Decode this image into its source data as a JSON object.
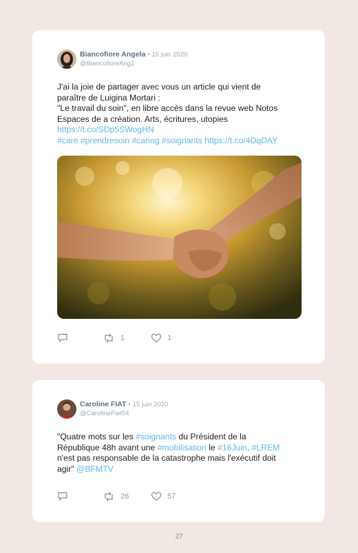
{
  "page_number": "27",
  "colors": {
    "background": "#f1e8e4",
    "card": "#ffffff",
    "name": "#5b6d84",
    "meta": "#9aa7b6",
    "link": "#5fb7e6"
  },
  "tweets": [
    {
      "author_name": "Biancofiore Angela",
      "separator": "•",
      "date": "15 juin 2020",
      "handle": "@BiancofioreAng1",
      "lines": [
        "J'ai la joie de partager avec vous un article qui vient de",
        "paraître de Luigina Mortari :",
        "\"Le travail du soin\", en libre accès dans la revue web Notos",
        "Espaces de a création. Arts, écritures, utopies"
      ],
      "link_line": "https://t.co/SDp5SWogHN",
      "hashtags": [
        "#care",
        "#prendresoin",
        "#caring",
        "#soignants"
      ],
      "trailing_link": "https://t.co/4DqDAY",
      "image": "photo of an adult's hand holding a child's hand against a golden sunset background",
      "reply_icon": "reply-icon",
      "retweet_icon": "retweet-icon",
      "like_icon": "heart-icon",
      "retweets": "1",
      "likes": "1"
    },
    {
      "author_name": "Caroline FIAT",
      "separator": "•",
      "date": "15 juin 2020",
      "handle": "@CarolineFiat54",
      "l1_a": "\"Quatre mots sur les ",
      "l1_tag": "#soignants",
      "l1_b": " du Président de la",
      "l2_a": "République 48h avant une ",
      "l2_tag": "#mobilisation",
      "l2_b": " le ",
      "l2_tag2": "#16Juin",
      "l2_c": ". ",
      "l2_tag3": "#LREM",
      "l3": "n'est pas responsable de la catastrophe mais l'exécutif doit",
      "l4_a": "agir\" ",
      "l4_tag": "@BFMTV",
      "reply_icon": "reply-icon",
      "retweet_icon": "retweet-icon",
      "like_icon": "heart-icon",
      "retweets": "26",
      "likes": "57"
    }
  ]
}
